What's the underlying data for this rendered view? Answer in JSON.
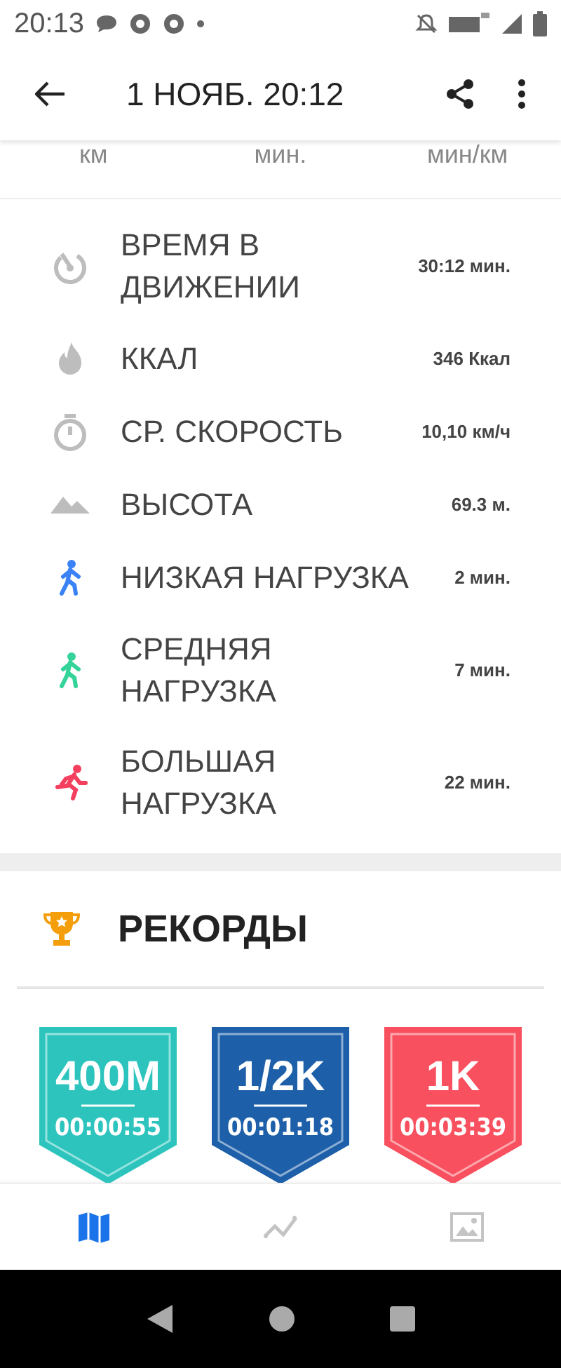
{
  "status_bar": {
    "time": "20:13"
  },
  "app_bar": {
    "title": "1 НОЯБ. 20:12"
  },
  "units": [
    "км",
    "мин.",
    "мин/км"
  ],
  "stats": [
    {
      "kind": "timer",
      "label": "ВРЕМЯ В ДВИЖЕНИИ",
      "value": "30:12 мин."
    },
    {
      "kind": "flame",
      "label": "ККАЛ",
      "value": "346 Ккал"
    },
    {
      "kind": "stopwatch",
      "label": "СР. СКОРОСТЬ",
      "value": "10,10 км/ч"
    },
    {
      "kind": "mountain",
      "label": "ВЫСОТА",
      "value": "69.3 м."
    },
    {
      "kind": "walk",
      "color": "#3b82f6",
      "label": "НИЗКАЯ НАГРУЗКА",
      "value": "2 мин."
    },
    {
      "kind": "walk",
      "color": "#34d399",
      "label": "СРЕДНЯЯ НАГРУЗКА",
      "value": "7 мин."
    },
    {
      "kind": "run",
      "color": "#f43f5e",
      "label": "БОЛЬШАЯ НАГРУЗКА",
      "value": "22 мин."
    }
  ],
  "records": {
    "title": "РЕКОРДЫ",
    "badges": [
      {
        "distance": "400M",
        "time": "00:00:55",
        "color": "#2cc4bd"
      },
      {
        "distance": "1/2K",
        "time": "00:01:18",
        "color": "#1d5fa8"
      },
      {
        "distance": "1K",
        "time": "00:03:39",
        "color": "#f8505e"
      }
    ]
  },
  "bottom_tabs": [
    {
      "kind": "map",
      "selected": true
    },
    {
      "kind": "chart",
      "selected": false
    },
    {
      "kind": "image",
      "selected": false
    }
  ]
}
